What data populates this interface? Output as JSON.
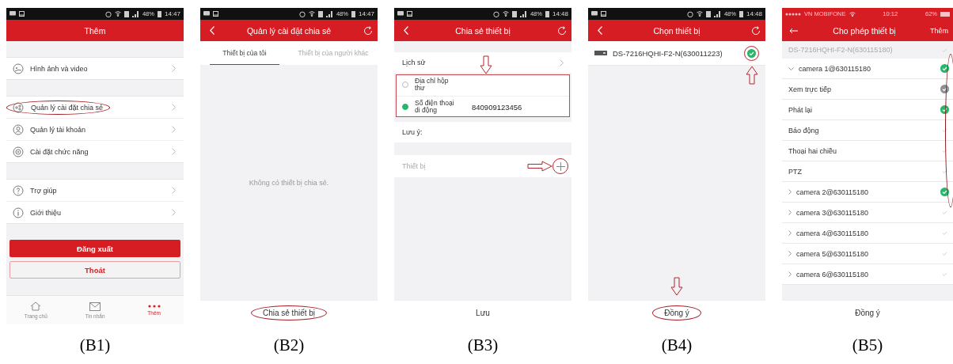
{
  "panels": [
    {
      "kind": "menu",
      "caption": "(B1)",
      "status": {
        "time": "14:47",
        "battery": "48%"
      },
      "header": {
        "title": "Thêm",
        "back": false,
        "refresh": false
      },
      "sections": [
        [
          {
            "label": "Hình ảnh và video",
            "circled": false
          }
        ],
        [
          {
            "label": "Quản lý cài đặt chia sẻ",
            "circled": true
          },
          {
            "label": "Quản lý tài khoản",
            "circled": false
          },
          {
            "label": "Cài đặt chức năng",
            "circled": false
          }
        ],
        [
          {
            "label": "Trợ giúp",
            "circled": false
          },
          {
            "label": "Giới thiệu",
            "circled": false
          }
        ]
      ],
      "buttons": [
        {
          "label": "Đăng xuất",
          "kind": "filled"
        },
        {
          "label": "Thoát",
          "kind": "outline"
        }
      ],
      "tabbar": [
        {
          "label": "Trang chủ",
          "selected": false
        },
        {
          "label": "Tin nhắn",
          "selected": false
        },
        {
          "label": "Thêm",
          "selected": true
        }
      ]
    },
    {
      "kind": "share_list",
      "caption": "(B2)",
      "status": {
        "time": "14:47",
        "battery": "48%"
      },
      "header": {
        "title": "Quản lý cài đặt chia sẻ",
        "back": true,
        "refresh": true
      },
      "tabs": [
        {
          "label": "Thiết bị của tôi",
          "selected": true
        },
        {
          "label": "Thiết bị của người khác",
          "selected": false
        }
      ],
      "empty_text": "Không có thiết bị chia sẻ.",
      "bottom_button": {
        "label": "Chia sẻ thiết bị",
        "circled": true,
        "pointer": false
      }
    },
    {
      "kind": "share_form",
      "caption": "(B3)",
      "status": {
        "time": "14:48",
        "battery": "48%"
      },
      "header": {
        "title": "Chia sẻ thiết bị",
        "back": true,
        "refresh": true
      },
      "history": {
        "label": "Lịch sử",
        "pointer": true
      },
      "options_boxed": true,
      "options": [
        {
          "label": "Địa chỉ hộp thư",
          "selected": false
        },
        {
          "label": "Số điện thoại di động",
          "selected": true,
          "value": "840909123456"
        }
      ],
      "note_label": "Lưu ý:",
      "device": {
        "label": "Thiết bị",
        "circled": true,
        "pointer": true
      },
      "bottom_button": {
        "label": "Lưu",
        "circled": false,
        "pointer": false
      }
    },
    {
      "kind": "device_pick",
      "caption": "(B4)",
      "status": {
        "time": "14:48",
        "battery": "48%"
      },
      "header": {
        "title": "Chọn thiết bị",
        "back": true,
        "refresh": true
      },
      "devices": [
        {
          "name": "DS-7216HQHI-F2-N(630011223)",
          "checked": true,
          "circled": true,
          "pointer": true
        }
      ],
      "bottom_button": {
        "label": "Đồng ý",
        "circled": true,
        "pointer": true
      }
    },
    {
      "kind": "permissions",
      "caption": "(B5)",
      "status": {
        "carrier": "VN MOBIFONE",
        "time": "10:12",
        "battery": "62%"
      },
      "header": {
        "title": "Cho phép thiết bị",
        "back": true,
        "refresh": false,
        "action": "Thêm"
      },
      "device_header": {
        "name": "DS-7216HQHI-F2-N(630115180)",
        "checked": false
      },
      "checks_circled": true,
      "tree": [
        {
          "label": "camera 1@630115180",
          "expanded": true,
          "checked": true,
          "disabled": false,
          "children": [
            {
              "label": "Xem trực tiếp",
              "checked": true,
              "disabled": true
            },
            {
              "label": "Phát lại",
              "checked": true,
              "disabled": false
            },
            {
              "label": "Báo động",
              "checked": false,
              "disabled": false
            },
            {
              "label": "Thoại hai chiều",
              "checked": false,
              "disabled": false
            },
            {
              "label": "PTZ",
              "checked": false,
              "disabled": false
            }
          ]
        },
        {
          "label": "camera 2@630115180",
          "expanded": false,
          "checked": true,
          "disabled": false
        },
        {
          "label": "camera 3@630115180",
          "expanded": false,
          "checked": false,
          "disabled": false
        },
        {
          "label": "camera 4@630115180",
          "expanded": false,
          "checked": false,
          "disabled": false
        },
        {
          "label": "camera 5@630115180",
          "expanded": false,
          "checked": false,
          "disabled": false
        },
        {
          "label": "camera 6@630115180",
          "expanded": false,
          "checked": false,
          "disabled": false
        }
      ],
      "bottom_button": {
        "label": "Đồng ý",
        "circled": false,
        "pointer": false
      }
    }
  ]
}
